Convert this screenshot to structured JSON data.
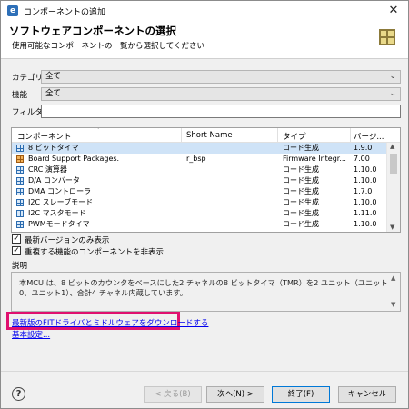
{
  "window": {
    "title": "コンポーネントの追加",
    "close_glyph": "✕"
  },
  "header": {
    "title": "ソフトウェアコンポーネントの選択",
    "subtitle": "使用可能なコンポーネントの一覧から選択してください"
  },
  "filters": {
    "category_label": "カテゴリ",
    "category_value": "全て",
    "function_label": "機能",
    "function_value": "全て",
    "filter_label": "フィルタ",
    "filter_value": ""
  },
  "table": {
    "columns": [
      "コンポーネント",
      "Short Name",
      "タイプ",
      "バージ..."
    ],
    "rows": [
      {
        "icon": "grid-icon",
        "name": "8 ビットタイマ",
        "short": "",
        "type": "コード生成",
        "version": "1.9.0",
        "selected": true
      },
      {
        "icon": "package-icon",
        "name": "Board Support Packages.",
        "short": "r_bsp",
        "type": "Firmware Integr...",
        "version": "7.00"
      },
      {
        "icon": "grid-icon",
        "name": "CRC 演算器",
        "short": "",
        "type": "コード生成",
        "version": "1.10.0"
      },
      {
        "icon": "grid-icon",
        "name": "D/A コンバータ",
        "short": "",
        "type": "コード生成",
        "version": "1.10.0"
      },
      {
        "icon": "grid-icon",
        "name": "DMA コントローラ",
        "short": "",
        "type": "コード生成",
        "version": "1.7.0"
      },
      {
        "icon": "grid-icon",
        "name": "I2C スレーブモード",
        "short": "",
        "type": "コード生成",
        "version": "1.10.0"
      },
      {
        "icon": "grid-icon",
        "name": "I2C マスタモード",
        "short": "",
        "type": "コード生成",
        "version": "1.11.0"
      },
      {
        "icon": "grid-icon",
        "name": "PWMモードタイマ",
        "short": "",
        "type": "コード生成",
        "version": "1.10.0"
      }
    ]
  },
  "options": {
    "latest_only_label": "最新バージョンのみ表示",
    "latest_only_checked": true,
    "hide_duplicates_label": "重複する機能のコンポーネントを非表示",
    "hide_duplicates_checked": true,
    "check_glyph": "✓"
  },
  "description": {
    "label": "説明",
    "text": "本MCU は、8 ビットのカウンタをベースにした2 チャネルの8 ビットタイマ（TMR）を2 ユニット（ユニット0、ユニット1）、合計4 チャネル内蔵しています。"
  },
  "links": {
    "download": "最新版のFITドライバとミドルウェアをダウンロードする",
    "basic_settings": "基本設定..."
  },
  "footer": {
    "help_glyph": "?",
    "back": "< 戻る(B)",
    "next": "次へ(N) >",
    "finish": "終了(F)",
    "cancel": "キャンセル"
  },
  "colors": {
    "highlight": "#e0106f",
    "selection": "#cfe3f7",
    "link": "#0000ee"
  }
}
